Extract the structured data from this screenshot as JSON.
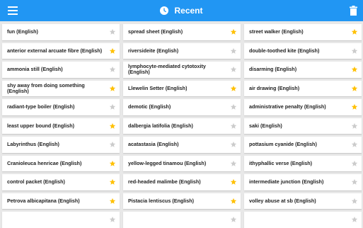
{
  "app": {
    "title": "Recent",
    "colors": {
      "appbar": "#2196f3",
      "star_on": "#ffc107",
      "star_off": "#cccccc"
    },
    "icons": {
      "menu": "menu-icon",
      "clock": "clock-icon",
      "delete": "trash-icon",
      "star": "star-icon"
    }
  },
  "columns": [
    [
      {
        "text": "fun (English)",
        "starred": false
      },
      {
        "text": "anterior external arcuate fibre (English)",
        "starred": true
      },
      {
        "text": "ammonia still (English)",
        "starred": false
      },
      {
        "text": "shy away from doing something (English)",
        "starred": true
      },
      {
        "text": "radiant-type boiler (English)",
        "starred": false
      },
      {
        "text": "least upper bound (English)",
        "starred": true
      },
      {
        "text": "Labyrinthus (English)",
        "starred": false
      },
      {
        "text": "Cranioleuca henricae (English)",
        "starred": true
      },
      {
        "text": "control packet (English)",
        "starred": true
      },
      {
        "text": "Petrova albicapitana (English)",
        "starred": true
      },
      {
        "text": "",
        "starred": false
      }
    ],
    [
      {
        "text": "spread sheet (English)",
        "starred": true
      },
      {
        "text": "riversideite (English)",
        "starred": false
      },
      {
        "text": "lymphocyte-mediated cytotoxity (English)",
        "starred": false
      },
      {
        "text": "Llewelin Setter (English)",
        "starred": true
      },
      {
        "text": "demotic (English)",
        "starred": false
      },
      {
        "text": "dalbergia latifolia (English)",
        "starred": false
      },
      {
        "text": "acatastasia (English)",
        "starred": false
      },
      {
        "text": "yellow-legged tinamou (English)",
        "starred": false
      },
      {
        "text": "red-headed malimbe (English)",
        "starred": true
      },
      {
        "text": "Pistacia lentiscus (English)",
        "starred": true
      },
      {
        "text": "",
        "starred": false
      }
    ],
    [
      {
        "text": "street walker (English)",
        "starred": true
      },
      {
        "text": "double-toothed kite (English)",
        "starred": false
      },
      {
        "text": "disarming (English)",
        "starred": true
      },
      {
        "text": "air drawing (English)",
        "starred": true
      },
      {
        "text": "administrative penalty (English)",
        "starred": true
      },
      {
        "text": "saki (English)",
        "starred": false
      },
      {
        "text": "pottasium cyanide (English)",
        "starred": false
      },
      {
        "text": "ithyphallic verse (English)",
        "starred": false
      },
      {
        "text": "intermediate junction (English)",
        "starred": false
      },
      {
        "text": "volley abuse at sb (English)",
        "starred": false
      },
      {
        "text": "",
        "starred": false
      }
    ]
  ]
}
